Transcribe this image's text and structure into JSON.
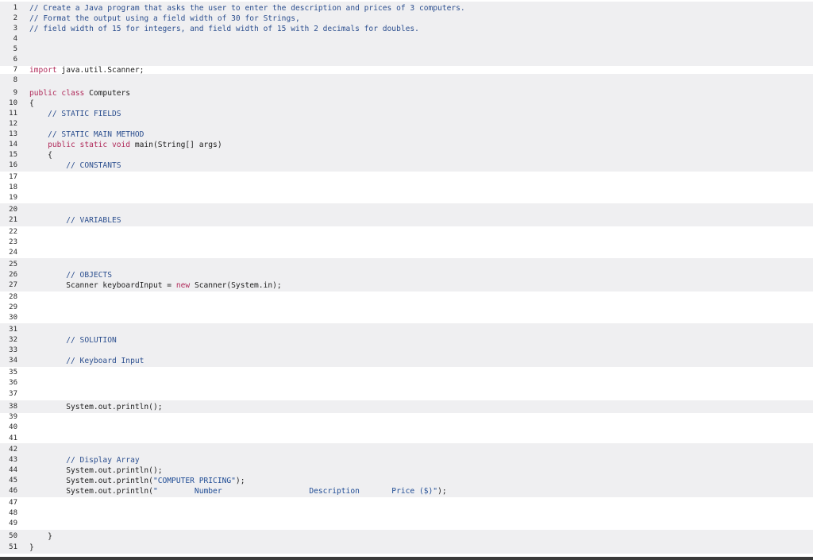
{
  "editor": {
    "language": "java",
    "colors": {
      "comment": "#2c4f8f",
      "keyword": "#b02a5a",
      "string": "#1f4c95",
      "text": "#202020",
      "band": "#efeff1",
      "background": "#ffffff"
    },
    "lines": [
      {
        "n": "1",
        "tokens": [
          {
            "t": "comment",
            "v": "// Create a Java program that asks the user to enter the description and prices of 3 computers."
          }
        ]
      },
      {
        "n": "2",
        "tokens": [
          {
            "t": "comment",
            "v": "// Format the output using a field width of 30 for Strings,"
          }
        ]
      },
      {
        "n": "3",
        "tokens": [
          {
            "t": "comment",
            "v": "// field width of 15 for integers, and field width of 15 with 2 decimals for doubles."
          }
        ]
      },
      {
        "n": "4",
        "tokens": []
      },
      {
        "n": "5",
        "tokens": []
      },
      {
        "n": "6",
        "tokens": []
      },
      {
        "n": "7",
        "tokens": [
          {
            "t": "keyword",
            "v": "import"
          },
          {
            "t": "plain",
            "v": " java.util.Scanner;"
          }
        ]
      },
      {
        "n": "8",
        "tokens": []
      },
      {
        "n": "9",
        "tokens": [
          {
            "t": "keyword",
            "v": "public class"
          },
          {
            "t": "plain",
            "v": " Computers"
          }
        ]
      },
      {
        "n": "10",
        "tokens": [
          {
            "t": "plain",
            "v": "{"
          }
        ]
      },
      {
        "n": "11",
        "tokens": [
          {
            "t": "plain",
            "v": "    "
          },
          {
            "t": "comment",
            "v": "// STATIC FIELDS"
          }
        ]
      },
      {
        "n": "12",
        "tokens": []
      },
      {
        "n": "13",
        "tokens": [
          {
            "t": "plain",
            "v": "    "
          },
          {
            "t": "comment",
            "v": "// STATIC MAIN METHOD"
          }
        ]
      },
      {
        "n": "14",
        "tokens": [
          {
            "t": "plain",
            "v": "    "
          },
          {
            "t": "keyword",
            "v": "public static void"
          },
          {
            "t": "plain",
            "v": " main(String[] args)"
          }
        ]
      },
      {
        "n": "15",
        "tokens": [
          {
            "t": "plain",
            "v": "    {"
          }
        ]
      },
      {
        "n": "16",
        "tokens": [
          {
            "t": "plain",
            "v": "        "
          },
          {
            "t": "comment",
            "v": "// CONSTANTS"
          }
        ]
      },
      {
        "n": "17",
        "tokens": []
      },
      {
        "n": "18",
        "tokens": []
      },
      {
        "n": "19",
        "tokens": []
      },
      {
        "n": "20",
        "tokens": []
      },
      {
        "n": "21",
        "tokens": [
          {
            "t": "plain",
            "v": "        "
          },
          {
            "t": "comment",
            "v": "// VARIABLES"
          }
        ]
      },
      {
        "n": "22",
        "tokens": []
      },
      {
        "n": "23",
        "tokens": []
      },
      {
        "n": "24",
        "tokens": []
      },
      {
        "n": "25",
        "tokens": []
      },
      {
        "n": "26",
        "tokens": [
          {
            "t": "plain",
            "v": "        "
          },
          {
            "t": "comment",
            "v": "// OBJECTS"
          }
        ]
      },
      {
        "n": "27",
        "tokens": [
          {
            "t": "plain",
            "v": "        Scanner keyboardInput = "
          },
          {
            "t": "keyword",
            "v": "new"
          },
          {
            "t": "plain",
            "v": " Scanner(System.in);"
          }
        ]
      },
      {
        "n": "28",
        "tokens": []
      },
      {
        "n": "29",
        "tokens": []
      },
      {
        "n": "30",
        "tokens": []
      },
      {
        "n": "31",
        "tokens": []
      },
      {
        "n": "32",
        "tokens": [
          {
            "t": "plain",
            "v": "        "
          },
          {
            "t": "comment",
            "v": "// SOLUTION"
          }
        ]
      },
      {
        "n": "33",
        "tokens": []
      },
      {
        "n": "34",
        "tokens": [
          {
            "t": "plain",
            "v": "        "
          },
          {
            "t": "comment",
            "v": "// Keyboard Input"
          }
        ]
      },
      {
        "n": "35",
        "tokens": []
      },
      {
        "n": "36",
        "tokens": []
      },
      {
        "n": "37",
        "tokens": []
      },
      {
        "n": "38",
        "tokens": [
          {
            "t": "plain",
            "v": "        System.out.println();"
          }
        ]
      },
      {
        "n": "39",
        "tokens": []
      },
      {
        "n": "40",
        "tokens": []
      },
      {
        "n": "41",
        "tokens": []
      },
      {
        "n": "42",
        "tokens": []
      },
      {
        "n": "43",
        "tokens": [
          {
            "t": "plain",
            "v": "        "
          },
          {
            "t": "comment",
            "v": "// Display Array"
          }
        ]
      },
      {
        "n": "44",
        "tokens": [
          {
            "t": "plain",
            "v": "        System.out.println();"
          }
        ]
      },
      {
        "n": "45",
        "tokens": [
          {
            "t": "plain",
            "v": "        System.out.println("
          },
          {
            "t": "string",
            "v": "\"COMPUTER PRICING\""
          },
          {
            "t": "plain",
            "v": ");"
          }
        ]
      },
      {
        "n": "46",
        "tokens": [
          {
            "t": "plain",
            "v": "        System.out.println("
          },
          {
            "t": "string",
            "v": "\"        Number                   Description       Price ($)\""
          },
          {
            "t": "plain",
            "v": ");"
          }
        ]
      },
      {
        "n": "47",
        "tokens": []
      },
      {
        "n": "48",
        "tokens": []
      },
      {
        "n": "49",
        "tokens": []
      },
      {
        "n": "50",
        "tokens": [
          {
            "t": "plain",
            "v": "    }"
          }
        ]
      },
      {
        "n": "51",
        "tokens": [
          {
            "t": "plain",
            "v": "}"
          }
        ]
      }
    ]
  }
}
